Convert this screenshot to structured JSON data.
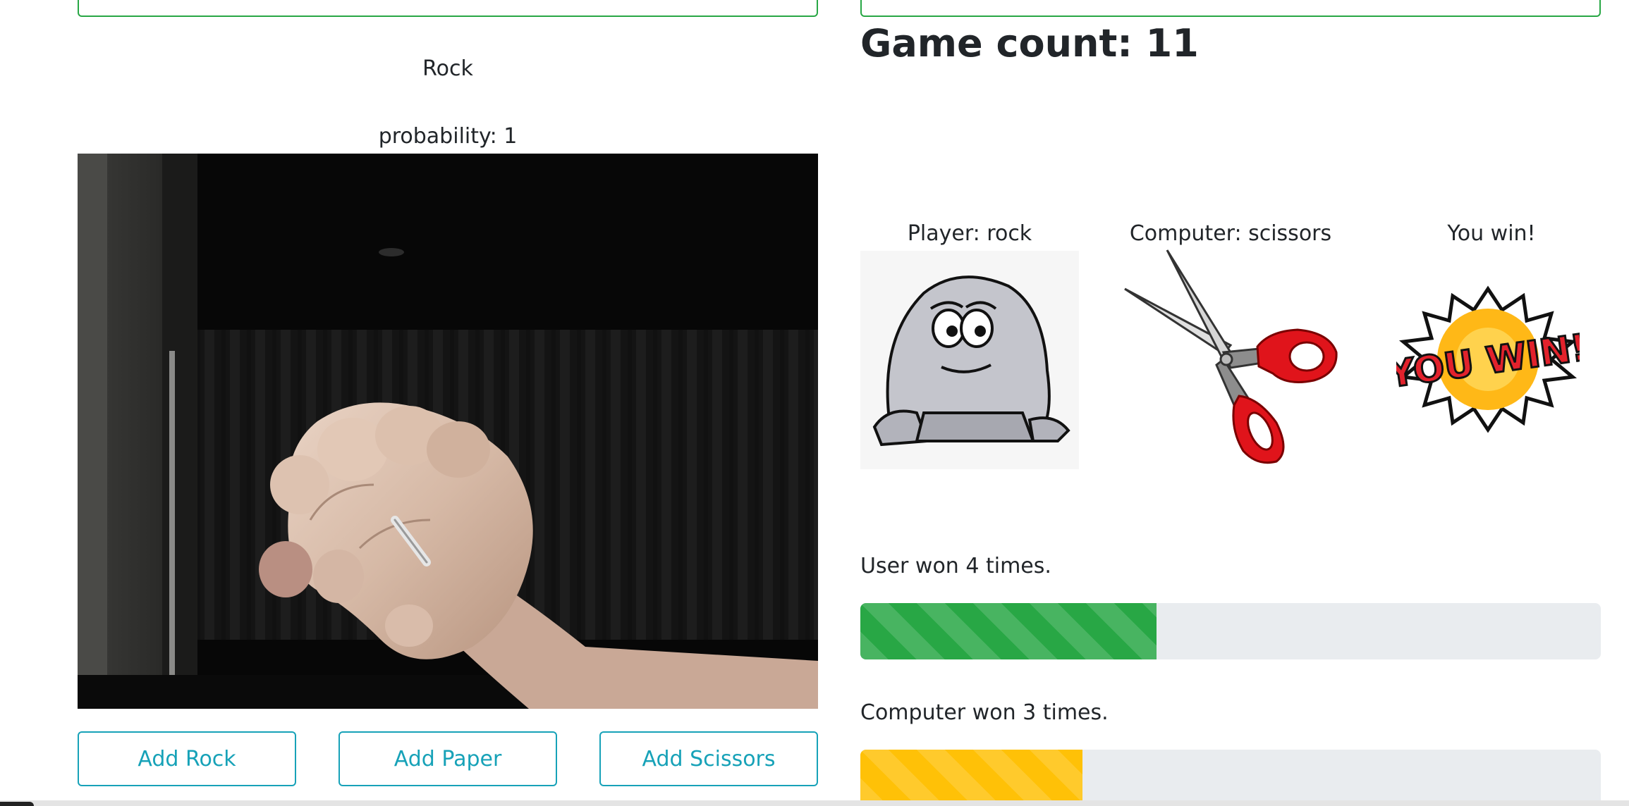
{
  "prediction": {
    "label": "Rock",
    "probability_text": "probability: 1"
  },
  "buttons": {
    "add_rock": "Add Rock",
    "add_paper": "Add Paper",
    "add_scissors": "Add Scissors"
  },
  "game": {
    "count_text": "Game count: 11",
    "player_text": "Player: rock",
    "computer_text": "Computer: scissors",
    "result_text": "You win!",
    "result_image_text": "YOU WIN!"
  },
  "stats": {
    "user_text": "User won 4 times.",
    "user_wins": 4,
    "user_progress_fraction": 0.4,
    "computer_text": "Computer won 3 times.",
    "computer_wins": 3,
    "computer_progress_fraction": 0.3
  },
  "colors": {
    "success": "#28a745",
    "warning": "#ffc107",
    "info": "#17a2b8",
    "track": "#e9ecef"
  }
}
